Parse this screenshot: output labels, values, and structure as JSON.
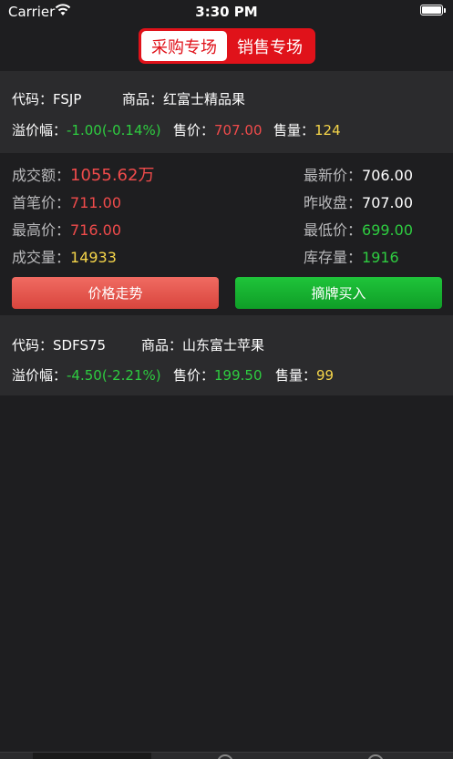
{
  "status": {
    "carrier": "Carrier",
    "time": "3:30 PM"
  },
  "segments": {
    "purchase": "采购专场",
    "sales": "销售专场"
  },
  "items": [
    {
      "code_label": "代码：",
      "code": "FSJP",
      "name_label": "商品：",
      "name": "红富士精品果",
      "premium_label": "溢价幅：",
      "premium": "-1.00(-0.14%)",
      "price_label": "售价：",
      "price": "707.00",
      "volume_label": "售量：",
      "volume": "124"
    },
    {
      "code_label": "代码：",
      "code": "SDFS75",
      "name_label": "商品：",
      "name": "山东富士苹果",
      "premium_label": "溢价幅：",
      "premium": "-4.50(-2.21%)",
      "price_label": "售价：",
      "price": "199.50",
      "volume_label": "售量：",
      "volume": "99"
    }
  ],
  "detail": {
    "turnover_label": "成交额：",
    "turnover": "1055.62万",
    "latest_label": "最新价：",
    "latest": "706.00",
    "first_label": "首笔价：",
    "first": "711.00",
    "prev_close_label": "昨收盘：",
    "prev_close": "707.00",
    "high_label": "最高价：",
    "high": "716.00",
    "low_label": "最低价：",
    "low": "699.00",
    "deal_volume_label": "成交量：",
    "deal_volume": "14933",
    "stock_label": "库存量：",
    "stock": "1916"
  },
  "buttons": {
    "chart": "价格走势",
    "buy": "摘牌买入"
  },
  "colors": {
    "accent_red": "#e0121a",
    "up_green": "#2ecc40",
    "down_red": "#f04b4b",
    "volume_yellow": "#f5d54a"
  }
}
